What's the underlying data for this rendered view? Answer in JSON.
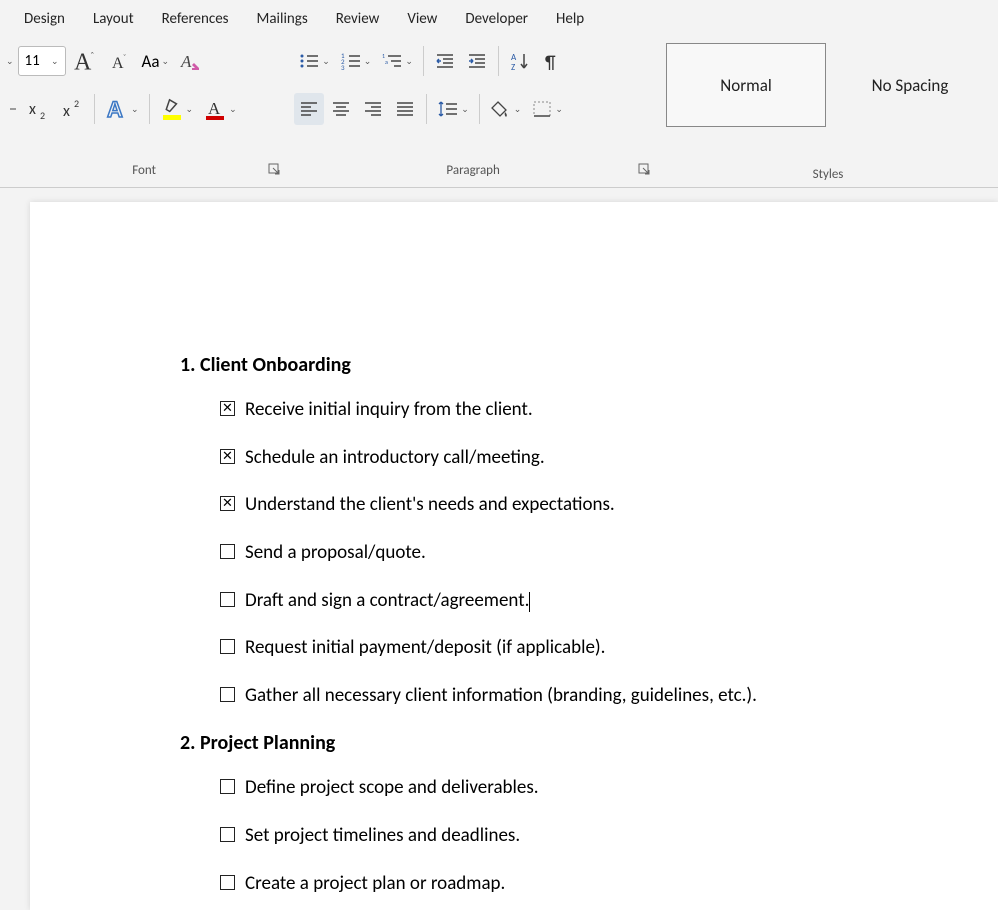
{
  "tabs": {
    "design": "Design",
    "layout": "Layout",
    "references": "References",
    "mailings": "Mailings",
    "review": "Review",
    "view": "View",
    "developer": "Developer",
    "help": "Help"
  },
  "font": {
    "size": "11",
    "aa_label": "Aa",
    "group_label": "Font"
  },
  "paragraph": {
    "group_label": "Paragraph"
  },
  "styles": {
    "normal": "Normal",
    "no_spacing": "No Spacing",
    "group_label": "Styles"
  },
  "document": {
    "section1": {
      "heading": "1. Client Onboarding",
      "items": [
        {
          "checked": true,
          "text": "Receive initial inquiry from the client."
        },
        {
          "checked": true,
          "text": "Schedule an introductory call/meeting."
        },
        {
          "checked": true,
          "text": "Understand the client's needs and expectations."
        },
        {
          "checked": false,
          "text": "Send a proposal/quote."
        },
        {
          "checked": false,
          "text": "Draft and sign a contract/agreement.",
          "cursor": true
        },
        {
          "checked": false,
          "text": "Request initial payment/deposit (if applicable)."
        },
        {
          "checked": false,
          "text": "Gather all necessary client information (branding, guidelines, etc.)."
        }
      ]
    },
    "section2": {
      "heading": "2. Project Planning",
      "items": [
        {
          "checked": false,
          "text": "Define project scope and deliverables."
        },
        {
          "checked": false,
          "text": "Set project timelines and deadlines."
        },
        {
          "checked": false,
          "text": "Create a project plan or roadmap."
        }
      ]
    }
  }
}
